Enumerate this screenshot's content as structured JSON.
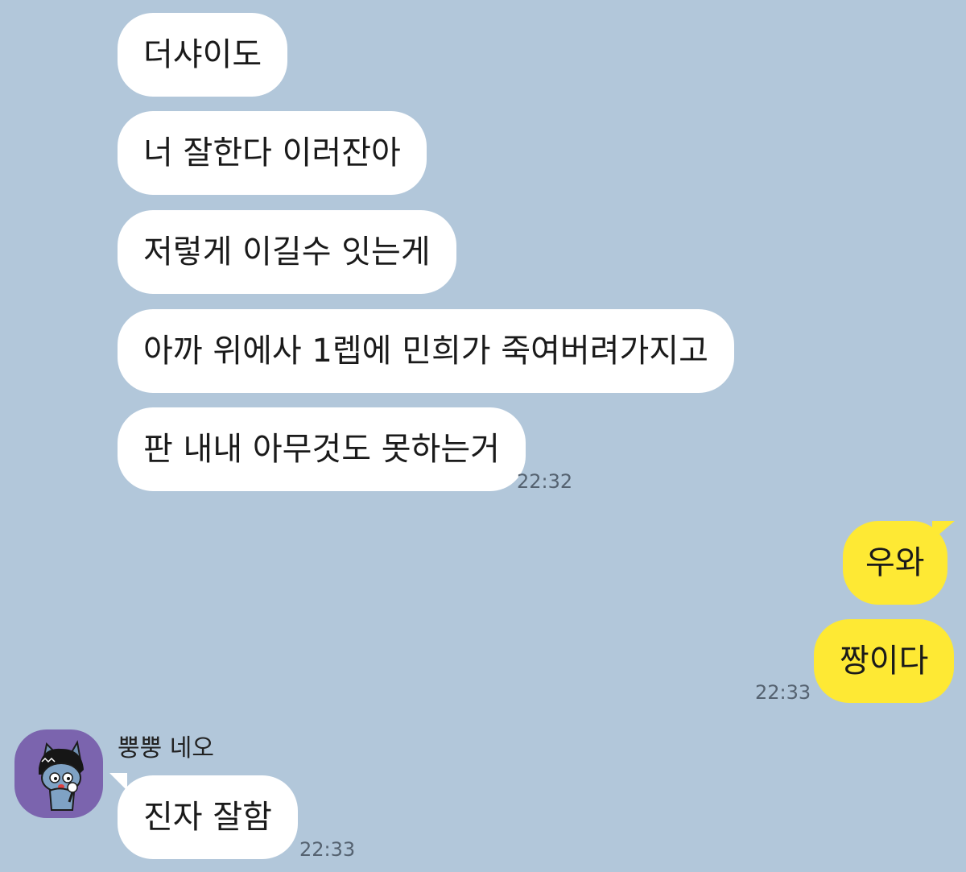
{
  "chat": {
    "incoming_group_1": {
      "messages": [
        "더샤이도",
        "너 잘한다 이러잔아",
        "저렇게 이길수 잇는게",
        "아까 위에사 1렙에 민희가 죽여버려가지고",
        "판 내내 아무것도 못하는거"
      ],
      "time": "22:32"
    },
    "outgoing_group": {
      "messages": [
        "우와",
        "짱이다"
      ],
      "time": "22:33"
    },
    "incoming_group_2": {
      "sender": "뿡뿡 네오",
      "avatar_icon": "neo-cat-character-icon",
      "messages": [
        "진자 잘함"
      ],
      "time": "22:33"
    }
  },
  "colors": {
    "background": "#b2c7da",
    "incoming_bubble": "#ffffff",
    "outgoing_bubble": "#fee934",
    "avatar_bg": "#7b64ae"
  }
}
